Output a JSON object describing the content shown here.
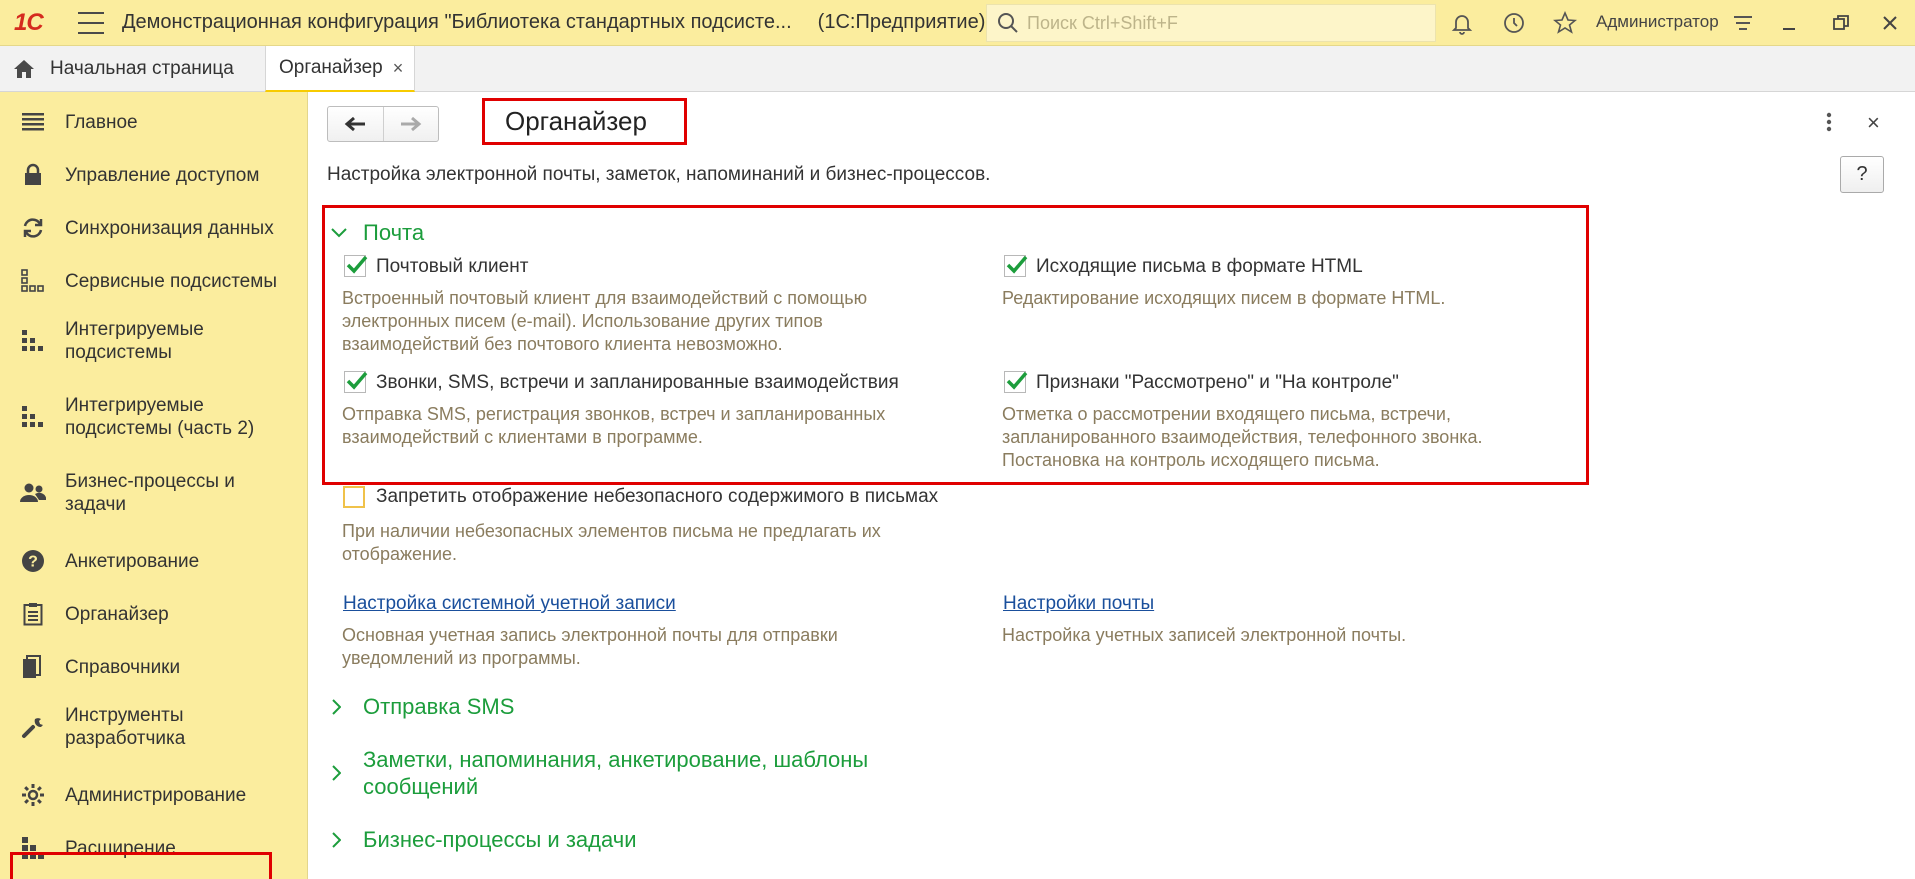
{
  "topbar": {
    "logo": "1С",
    "app_title": "Демонстрационная конфигурация \"Библиотека стандартных подсисте...",
    "platform": "(1С:Предприятие)",
    "search_placeholder": "Поиск Ctrl+Shift+F",
    "user": "Администратор"
  },
  "tabs": {
    "home": "Начальная страница",
    "active": "Органайзер",
    "active_close": "×"
  },
  "sidebar": {
    "items": [
      {
        "label": "Главное",
        "icon": "list-icon"
      },
      {
        "label": "Управление доступом",
        "icon": "lock-icon"
      },
      {
        "label": "Синхронизация данных",
        "icon": "sync-icon"
      },
      {
        "label": "Сервисные подсистемы",
        "icon": "subsystems-icon"
      },
      {
        "label": "Интегрируемые\nподсистемы",
        "icon": "blocks-icon"
      },
      {
        "label": "Интегрируемые\nподсистемы (часть 2)",
        "icon": "blocks-icon"
      },
      {
        "label": "Бизнес-процессы и\nзадачи",
        "icon": "users-icon"
      },
      {
        "label": "Анкетирование",
        "icon": "question-icon"
      },
      {
        "label": "Органайзер",
        "icon": "clipboard-icon"
      },
      {
        "label": "Справочники",
        "icon": "books-icon"
      },
      {
        "label": "Инструменты\nразработчика",
        "icon": "wrench-icon"
      },
      {
        "label": "Администрирование",
        "icon": "gear-icon"
      },
      {
        "label": "Расширение",
        "icon": "extension-icon"
      }
    ]
  },
  "page": {
    "title": "Органайзер",
    "description": "Настройка электронной почты, заметок, напоминаний и бизнес-процессов.",
    "help": "?",
    "close": "×"
  },
  "mail": {
    "title": "Почта",
    "options": [
      {
        "label": "Почтовый клиент",
        "checked": true,
        "hint": "Встроенный почтовый клиент для взаимодействий с помощью\nэлектронных писем (e-mail). Использование других типов\nвзаимодействий без почтового клиента невозможно."
      },
      {
        "label": "Исходящие письма в формате HTML",
        "checked": true,
        "hint": "Редактирование исходящих писем в формате HTML."
      },
      {
        "label": "Звонки, SMS, встречи и запланированные взаимодействия",
        "checked": true,
        "hint": "Отправка SMS, регистрация звонков, встреч и запланированных\nвзаимодействий с клиентами в программе."
      },
      {
        "label": "Признаки \"Рассмотрено\" и \"На контроле\"",
        "checked": true,
        "hint": "Отметка о рассмотрении входящего письма, встречи,\nзапланированного взаимодействия, телефонного звонка.\nПостановка на контроль исходящего письма."
      },
      {
        "label": "Запретить отображение небезопасного содержимого в письмах",
        "checked": false,
        "hint": "При наличии небезопасных элементов письма не предлагать их\nотображение."
      }
    ],
    "links": [
      {
        "label": "Настройка системной учетной записи",
        "hint": "Основная учетная запись электронной почты для отправки\nуведомлений из программы."
      },
      {
        "label": "Настройки почты",
        "hint": "Настройка учетных записей электронной почты."
      }
    ]
  },
  "sections": [
    {
      "title": "Отправка SMS"
    },
    {
      "title": "Заметки, напоминания, анкетирование, шаблоны\nсообщений"
    },
    {
      "title": "Бизнес-процессы и задачи"
    }
  ],
  "colors": {
    "accent_yellow": "#fbed9e",
    "section_green": "#1c9d3c",
    "highlight_red": "#e00000",
    "link_blue": "#1a4f9c",
    "hint_brown": "#8a7c5e"
  }
}
